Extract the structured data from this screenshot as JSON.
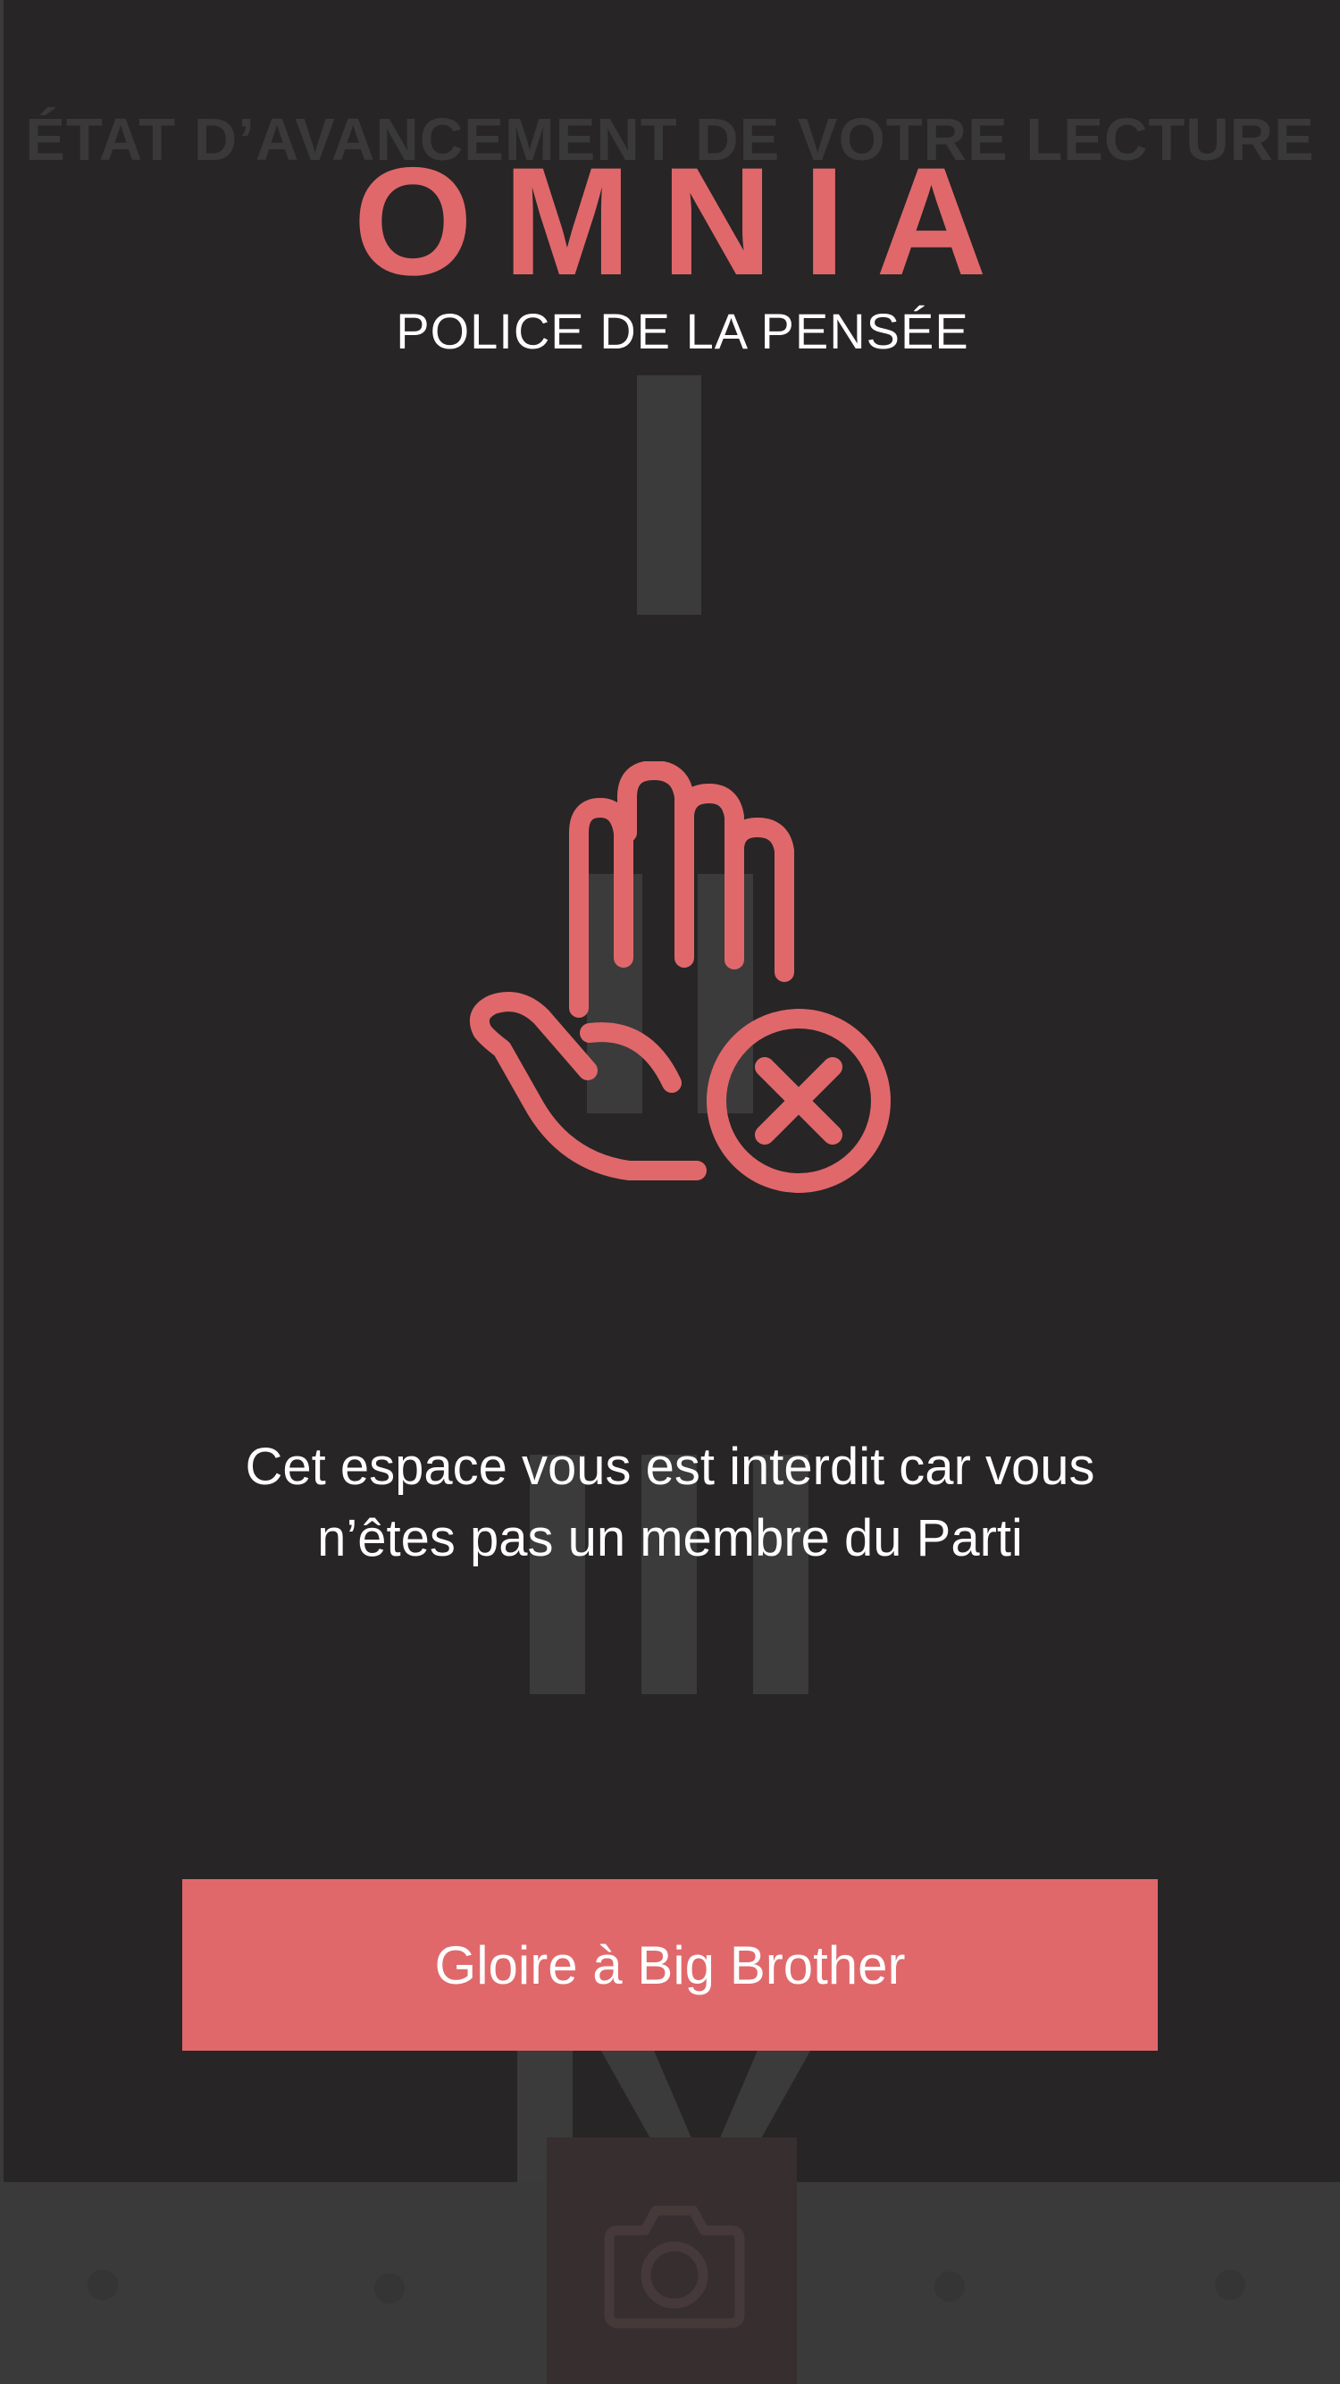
{
  "background": {
    "heading": "ÉTAT D’AVANCEMENT DE VOTRE LECTURE"
  },
  "header": {
    "brand": "OMNIA",
    "subtitle": "POLICE DE LA PENSÉE"
  },
  "main": {
    "icon": "hand-stop-forbidden-icon",
    "message_line1": "Cet espace vous est interdit car vous",
    "message_line2": "n’êtes pas un membre du Parti",
    "button_label": "Gloire à Big Brother"
  },
  "bottom_nav": {
    "center_icon": "camera-icon"
  },
  "colors": {
    "accent": "#e0686b",
    "background": "#272526",
    "bar": "#3a3a3a",
    "text": "#ffffff"
  }
}
